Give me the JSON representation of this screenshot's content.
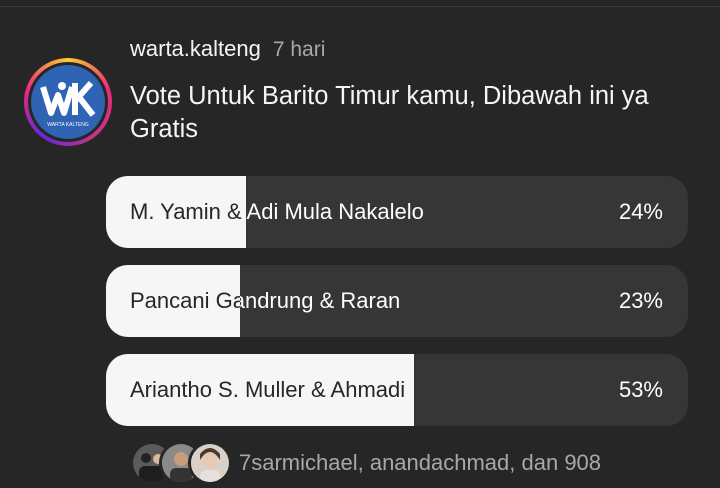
{
  "post": {
    "username": "warta.kalteng",
    "time": "7 hari",
    "caption": "Vote Untuk Barito Timur kamu, Dibawah ini ya Gratis",
    "logo_letters": "WK",
    "logo_subtext": "WARTA KALTENG"
  },
  "poll": {
    "options": [
      {
        "label": "M. Yamin & Adi Mula Nakalelo",
        "percent": "24%",
        "fill_fraction": 0.24
      },
      {
        "label": "Pancani Gandrung & Raran",
        "percent": "23%",
        "fill_fraction": 0.23
      },
      {
        "label": "Ariantho S. Muller & Ahmadi",
        "percent": "53%",
        "fill_fraction": 0.53
      }
    ]
  },
  "voters": {
    "text": "7sarmichael, anandachmad, dan 908"
  },
  "colors": {
    "background": "#262626",
    "fill": "#f6f6f6",
    "track": "#363636",
    "logo_blue": "#2f63b3"
  }
}
